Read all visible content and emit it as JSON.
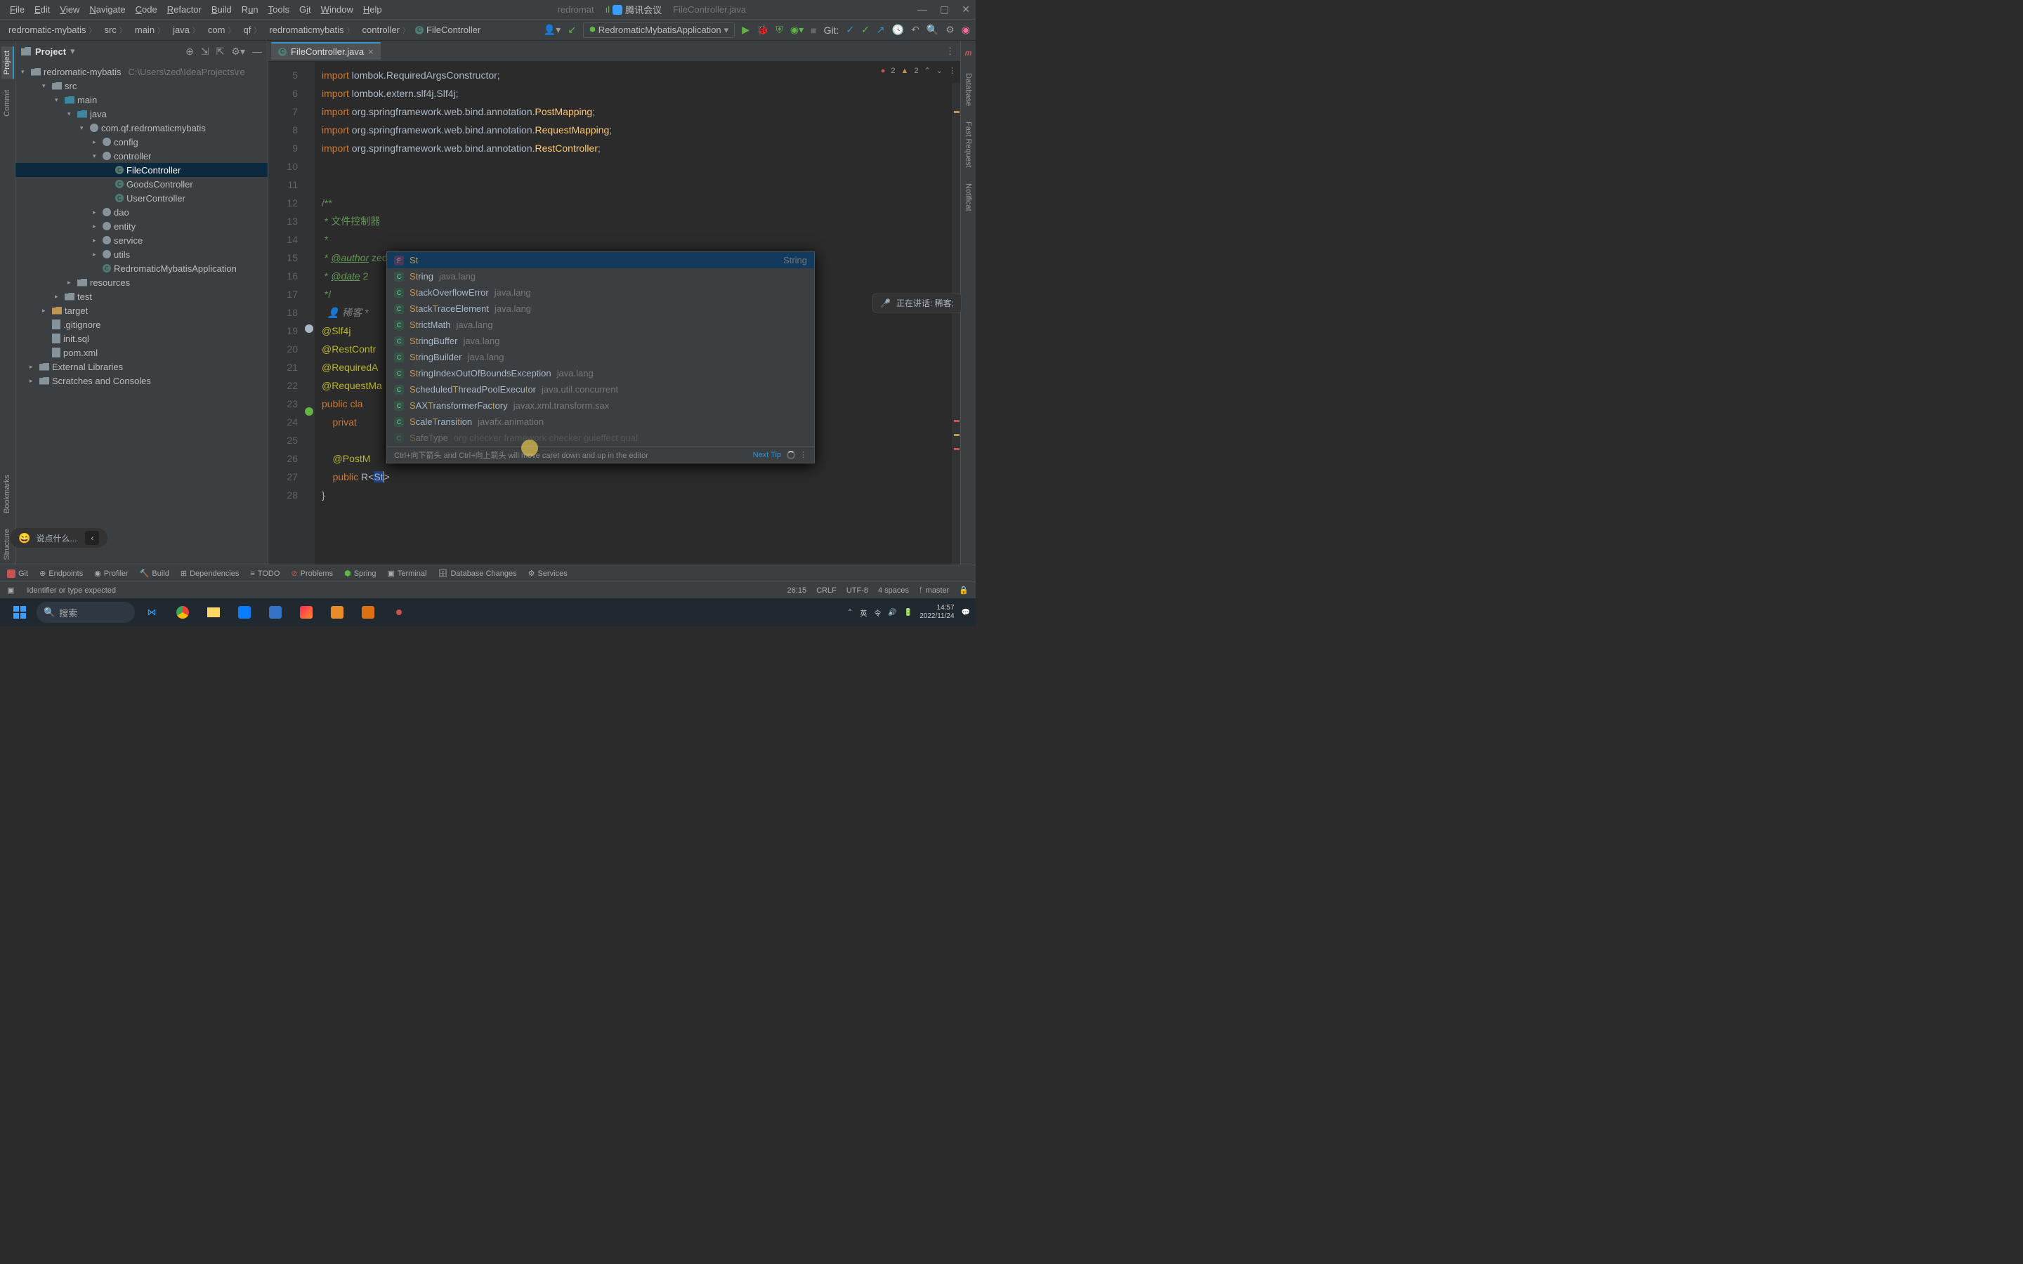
{
  "title_bar": {
    "menus": [
      "File",
      "Edit",
      "View",
      "Navigate",
      "Code",
      "Refactor",
      "Build",
      "Run",
      "Tools",
      "Git",
      "Window",
      "Help"
    ],
    "project_hint": "redromat",
    "center_app": "腾讯会议",
    "filename": "FileController.java"
  },
  "breadcrumbs": [
    "redromatic-mybatis",
    "src",
    "main",
    "java",
    "com",
    "qf",
    "redromaticmybatis",
    "controller"
  ],
  "breadcrumb_file": "FileController",
  "run_config": "RedromaticMybatisApplication",
  "git_label": "Git:",
  "project_panel": {
    "title": "Project",
    "root": "redromatic-mybatis",
    "root_hint": "C:\\Users\\zed\\IdeaProjects\\re",
    "items": [
      {
        "depth": 1,
        "arrow": "▾",
        "icon": "fld",
        "label": "src"
      },
      {
        "depth": 2,
        "arrow": "▾",
        "icon": "fld blue",
        "label": "main"
      },
      {
        "depth": 3,
        "arrow": "▾",
        "icon": "fld blue",
        "label": "java"
      },
      {
        "depth": 4,
        "arrow": "▾",
        "icon": "pkg",
        "label": "com.qf.redromaticmybatis"
      },
      {
        "depth": 5,
        "arrow": "▸",
        "icon": "pkg",
        "label": "config"
      },
      {
        "depth": 5,
        "arrow": "▾",
        "icon": "pkg",
        "label": "controller"
      },
      {
        "depth": 6,
        "arrow": "",
        "icon": "cls",
        "label": "FileController",
        "sel": true
      },
      {
        "depth": 6,
        "arrow": "",
        "icon": "cls",
        "label": "GoodsController"
      },
      {
        "depth": 6,
        "arrow": "",
        "icon": "cls",
        "label": "UserController"
      },
      {
        "depth": 5,
        "arrow": "▸",
        "icon": "pkg",
        "label": "dao"
      },
      {
        "depth": 5,
        "arrow": "▸",
        "icon": "pkg",
        "label": "entity"
      },
      {
        "depth": 5,
        "arrow": "▸",
        "icon": "pkg",
        "label": "service"
      },
      {
        "depth": 5,
        "arrow": "▸",
        "icon": "pkg",
        "label": "utils"
      },
      {
        "depth": 5,
        "arrow": "",
        "icon": "cls",
        "label": "RedromaticMybatisApplication"
      },
      {
        "depth": 3,
        "arrow": "▸",
        "icon": "fld",
        "label": "resources"
      },
      {
        "depth": 2,
        "arrow": "▸",
        "icon": "fld",
        "label": "test"
      },
      {
        "depth": 1,
        "arrow": "▸",
        "icon": "fld orange",
        "label": "target"
      },
      {
        "depth": 1,
        "arrow": "",
        "icon": "file",
        "label": ".gitignore"
      },
      {
        "depth": 1,
        "arrow": "",
        "icon": "file",
        "label": "init.sql"
      },
      {
        "depth": 1,
        "arrow": "",
        "icon": "file",
        "label": "pom.xml"
      },
      {
        "depth": 0,
        "arrow": "▸",
        "icon": "fld",
        "label": "External Libraries"
      },
      {
        "depth": 0,
        "arrow": "▸",
        "icon": "fld",
        "label": "Scratches and Consoles"
      }
    ]
  },
  "editor": {
    "tab": "FileController.java",
    "warnings": {
      "errors": "2",
      "warns": "2"
    },
    "line_numbers": [
      "5",
      "6",
      "7",
      "8",
      "9",
      "10",
      "11",
      "12",
      "13",
      "14",
      "15",
      "16",
      "17",
      "",
      "18",
      "19",
      "20",
      "21",
      "22",
      "23",
      "24",
      "25",
      "26",
      "27",
      "28"
    ],
    "inlay_author": "稀客 *",
    "code": {
      "l5": "import lombok.RequiredArgsConstructor;",
      "l6": "import lombok.extern.slf4j.Slf4j;",
      "l7": "import org.springframework.web.bind.annotation.PostMapping;",
      "l8": "import org.springframework.web.bind.annotation.RequestMapping;",
      "l9": "import org.springframework.web.bind.annotation.RestController;",
      "l12": "/**",
      "l13": " * 文件控制器",
      "l14": " *",
      "l15a": "@author",
      "l15b": " zed",
      "l16a": "@date",
      "l16b": " 2",
      "l17": " */",
      "l18": "@Slf4j",
      "l19": "@RestContr",
      "l20": "@RequiredA",
      "l21": "@RequestMa",
      "l22": "public cla",
      "l23": "    privat",
      "l25": "    @PostM",
      "l26a": "    public ",
      "l26b": "R",
      "l26c": "<",
      "l26d": "St",
      "l26e": ">",
      "l27": "}"
    }
  },
  "popup": {
    "selected_tail": "String",
    "items": [
      {
        "icon": "f",
        "name": "St",
        "pkg": "",
        "sel": true,
        "tail": "String"
      },
      {
        "icon": "c",
        "name": "String",
        "pkg": "java.lang"
      },
      {
        "icon": "c",
        "name": "StackOverflowError",
        "pkg": "java.lang"
      },
      {
        "icon": "c",
        "name": "StackTraceElement",
        "pkg": "java.lang"
      },
      {
        "icon": "c",
        "name": "StrictMath",
        "pkg": "java.lang"
      },
      {
        "icon": "c",
        "name": "StringBuffer",
        "pkg": "java.lang"
      },
      {
        "icon": "c",
        "name": "StringBuilder",
        "pkg": "java.lang"
      },
      {
        "icon": "c",
        "name": "StringIndexOutOfBoundsException",
        "pkg": "java.lang"
      },
      {
        "icon": "c",
        "name": "ScheduledThreadPoolExecutor",
        "pkg": "java.util.concurrent"
      },
      {
        "icon": "c",
        "name": "SAXTransformerFactory",
        "pkg": "javax.xml.transform.sax"
      },
      {
        "icon": "c",
        "name": "ScaleTransition",
        "pkg": "javafx.animation"
      },
      {
        "icon": "c",
        "name": "SafeType",
        "pkg": "org checker framework checker guieffect qual",
        "cut": true
      }
    ],
    "footer_hint": "Ctrl+向下箭头 and Ctrl+向上箭头 will move caret down and up in the editor",
    "next_tip": "Next Tip"
  },
  "mic_widget": "正在讲话: 稀客;",
  "comment_widget": "说点什么...",
  "left_tabs": [
    "Project",
    "Commit",
    "Bookmarks",
    "Structure"
  ],
  "right_tabs": [
    "m",
    "Database",
    "Fast Request",
    "Notificat"
  ],
  "tool_bar": [
    "Git",
    "Endpoints",
    "Profiler",
    "Build",
    "Dependencies",
    "TODO",
    "Problems",
    "Spring",
    "Terminal",
    "Database Changes",
    "Services"
  ],
  "status": {
    "message": "Identifier or type expected",
    "pos": "26:15",
    "sep": "CRLF",
    "enc": "UTF-8",
    "indent": "4 spaces",
    "branch": "master"
  },
  "taskbar": {
    "search": "搜索",
    "tray": {
      "ime": "英",
      "net": "令",
      "time": "14:57",
      "date": "2022/11/24"
    }
  }
}
